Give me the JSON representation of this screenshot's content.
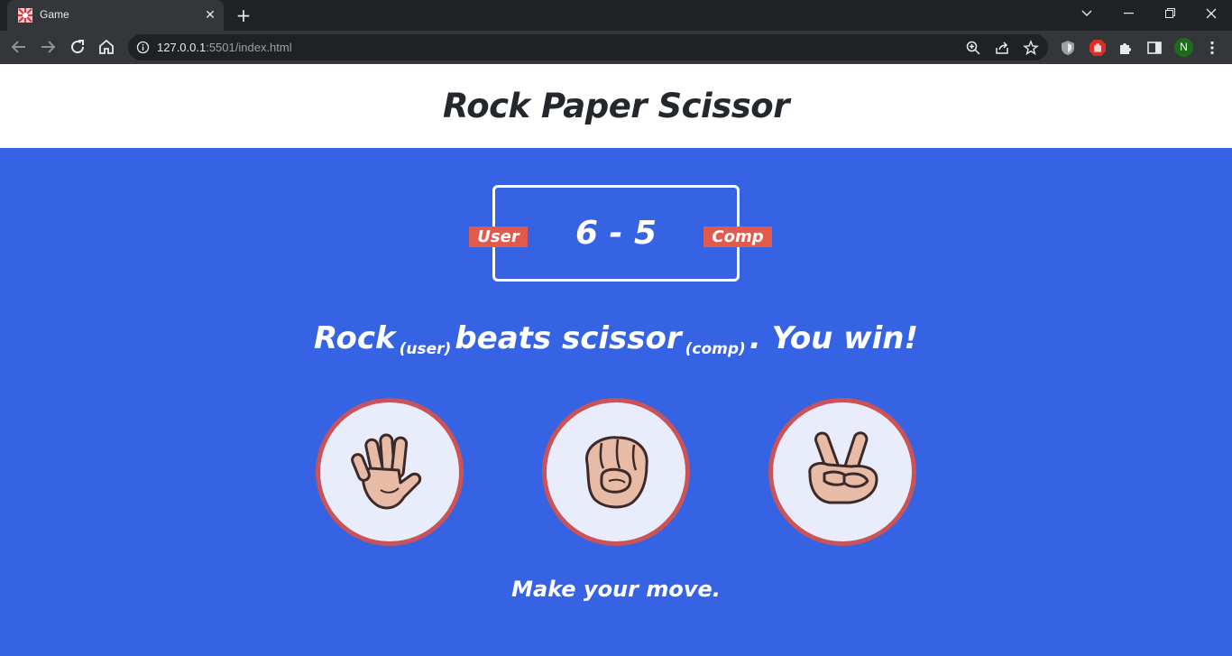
{
  "browser": {
    "tab_title": "Game",
    "url_host": "127.0.0.1",
    "url_rest": ":5501/index.html",
    "profile_initial": "N"
  },
  "page": {
    "title": "Rock Paper Scissor"
  },
  "score": {
    "text": "6 - 5",
    "user_label": "User",
    "comp_label": "Comp"
  },
  "result": {
    "part1": "Rock",
    "user_tag": "(user)",
    "part2": "beats scissor",
    "comp_tag": "(comp)",
    "part3": ". You win!"
  },
  "choices": [
    {
      "name": "paper",
      "icon": "open-hand-icon"
    },
    {
      "name": "rock",
      "icon": "fist-icon"
    },
    {
      "name": "scissors",
      "icon": "victory-hand-icon"
    }
  ],
  "message": "Make your move.",
  "colors": {
    "background": "#3563e3",
    "badge": "#e05a4e",
    "choice_border": "#c95359"
  }
}
